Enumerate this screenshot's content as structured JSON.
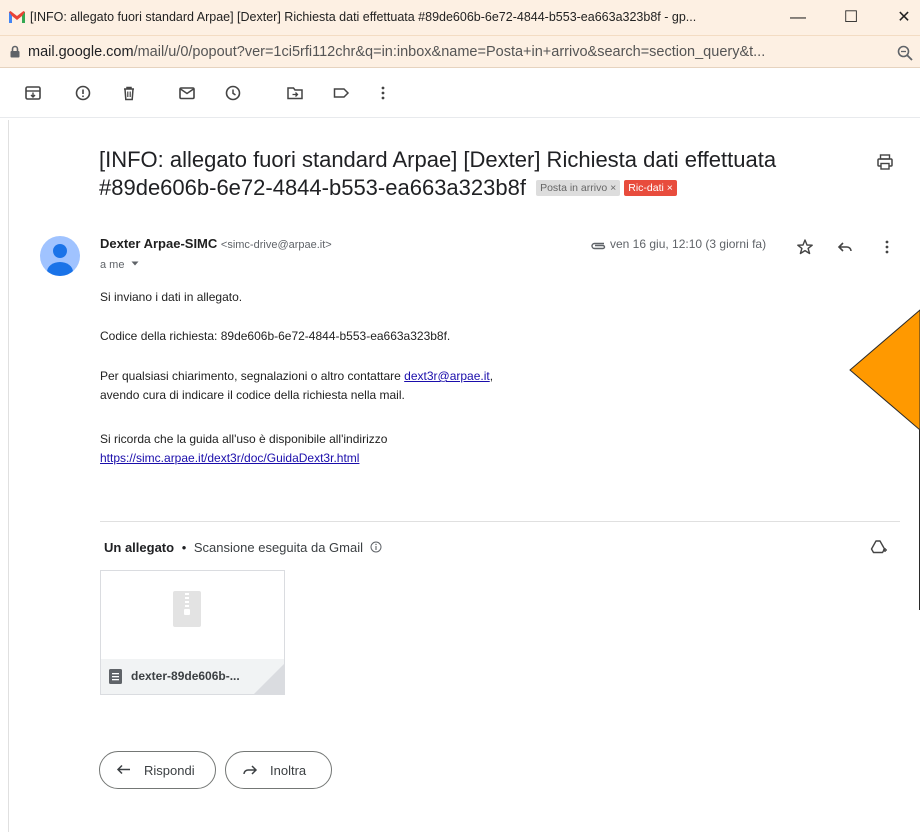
{
  "window": {
    "title": "[INFO: allegato fuori standard Arpae] [Dexter] Richiesta dati effettuata #89de606b-6e72-4844-b553-ea663a323b8f - gp...",
    "minimize": "—",
    "maximize": "☐",
    "close": "✕"
  },
  "address_bar": {
    "host": "mail.google.com",
    "path": "/mail/u/0/popout?ver=1ci5rfi112chr&q=in:inbox&name=Posta+in+arrivo&search=section_query&t..."
  },
  "toolbar": {
    "icons": [
      "archive-icon",
      "report-spam-icon",
      "delete-icon",
      "mark-unread-icon",
      "snooze-icon",
      "move-to-icon",
      "label-icon",
      "more-vert-icon"
    ]
  },
  "email": {
    "subject": "[INFO: allegato fuori standard Arpae] [Dexter] Richiesta dati effettuata #89de606b-6e72-4844-b553-ea663a323b8f",
    "labels": [
      {
        "text": "Posta in arrivo",
        "close": "×"
      },
      {
        "text": "Ric-dati",
        "close": "×",
        "color": "#e84c3d"
      }
    ],
    "sender_name": "Dexter Arpae-SIMC",
    "sender_email": "<simc-drive@arpae.it>",
    "recipient": "a me",
    "date": "ven 16 giu, 12:10 (3 giorni fa)",
    "body": {
      "line1": "Si inviano i dati in allegato.",
      "line2": "Codice della richiesta: 89de606b-6e72-4844-b553-ea663a323b8f.",
      "line3_prefix": "Per qualsiasi chiarimento, segnalazioni o altro contattare ",
      "line3_link": "dext3r@arpae.it",
      "line3_suffix": ",",
      "line4": "avendo cura di indicare il codice della richiesta nella mail.",
      "line5": "Si ricorda che la guida all'uso è disponibile all'indirizzo",
      "line6_link": "https://simc.arpae.it/dext3r/doc/GuidaDext3r.html"
    }
  },
  "attachments": {
    "title": "Un allegato",
    "separator": "•",
    "scan_text": "Scansione eseguita da Gmail",
    "file_name": "dexter-89de606b-..."
  },
  "actions": {
    "reply": "Rispondi",
    "forward": "Inoltra"
  },
  "colors": {
    "titlebar": "#fdf0e3",
    "label_red": "#e84c3d",
    "link": "#1a0dab",
    "overlay_orange": "#ff9900"
  }
}
